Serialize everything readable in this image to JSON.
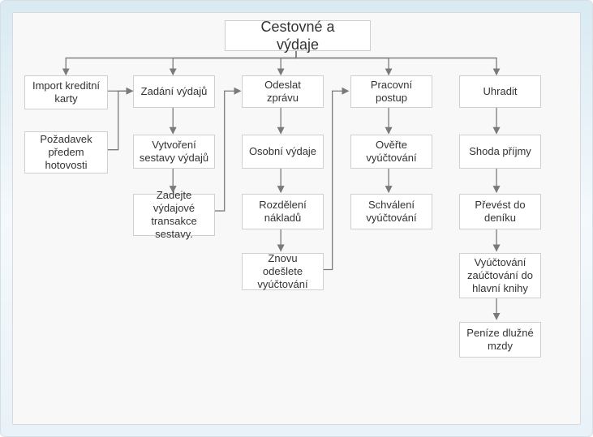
{
  "title": "Cestovné a výdaje",
  "nodes": {
    "import_card": "Import kreditní karty",
    "cash_advance": "Požadavek předem hotovosti",
    "enter_expenses": "Zadání výdajů",
    "create_report": "Vytvoření sestavy výdajů",
    "enter_report_tx": "Zadejte výdajové transakce sestavy.",
    "send_report": "Odeslat zprávu",
    "personal_expenses": "Osobní výdaje",
    "cost_split": "Rozdělení nákladů",
    "resend_report": "Znovu odešlete vyúčtování",
    "workflow": "Pracovní postup",
    "verify_report": "Ověřte vyúčtování",
    "approve_report": "Schválení vyúčtování",
    "reimburse": "Uhradit",
    "match_receipts": "Shoda příjmy",
    "transfer_journal": "Převést do deníku",
    "post_gl": "Vyúčtování zaúčtování do hlavní knihy",
    "money_owed": "Peníze dlužné mzdy"
  },
  "chart_data": {
    "type": "flowchart",
    "root": "title",
    "columns": [
      [
        "import_card",
        "cash_advance"
      ],
      [
        "enter_expenses",
        "create_report",
        "enter_report_tx"
      ],
      [
        "send_report",
        "personal_expenses",
        "cost_split",
        "resend_report"
      ],
      [
        "workflow",
        "verify_report",
        "approve_report"
      ],
      [
        "reimburse",
        "match_receipts",
        "transfer_journal",
        "post_gl",
        "money_owed"
      ]
    ],
    "edges": [
      [
        "title",
        "import_card"
      ],
      [
        "title",
        "enter_expenses"
      ],
      [
        "title",
        "send_report"
      ],
      [
        "title",
        "workflow"
      ],
      [
        "title",
        "reimburse"
      ],
      [
        "import_card",
        "enter_expenses"
      ],
      [
        "cash_advance",
        "enter_expenses"
      ],
      [
        "enter_expenses",
        "create_report"
      ],
      [
        "create_report",
        "enter_report_tx"
      ],
      [
        "enter_report_tx",
        "send_report"
      ],
      [
        "send_report",
        "personal_expenses"
      ],
      [
        "personal_expenses",
        "cost_split"
      ],
      [
        "cost_split",
        "resend_report"
      ],
      [
        "resend_report",
        "workflow"
      ],
      [
        "workflow",
        "verify_report"
      ],
      [
        "verify_report",
        "approve_report"
      ],
      [
        "reimburse",
        "match_receipts"
      ],
      [
        "match_receipts",
        "transfer_journal"
      ],
      [
        "transfer_journal",
        "post_gl"
      ],
      [
        "post_gl",
        "money_owed"
      ]
    ]
  }
}
